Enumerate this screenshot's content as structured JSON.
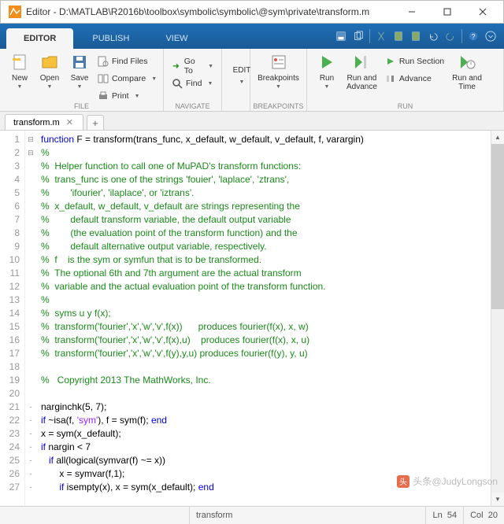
{
  "window": {
    "title": "Editor - D:\\MATLAB\\R2016b\\toolbox\\symbolic\\symbolic\\@sym\\private\\transform.m"
  },
  "tabs": {
    "editor": "EDITOR",
    "publish": "PUBLISH",
    "view": "VIEW"
  },
  "ribbon": {
    "file": {
      "label": "FILE",
      "new": "New",
      "open": "Open",
      "save": "Save",
      "findFiles": "Find Files",
      "compare": "Compare",
      "print": "Print"
    },
    "navigate": {
      "label": "NAVIGATE",
      "goto": "Go To",
      "find": "Find"
    },
    "edit": {
      "label": "EDIT"
    },
    "breakpoints": {
      "label": "BREAKPOINTS",
      "btn": "Breakpoints"
    },
    "run": {
      "label": "RUN",
      "run": "Run",
      "runAdvance": "Run and\nAdvance",
      "runSection": "Run Section",
      "advance": "Advance",
      "runTime": "Run and\nTime"
    }
  },
  "file_tab": "transform.m",
  "code": {
    "lines": [
      {
        "n": 1,
        "f": "⊟",
        "seg": [
          [
            "kw",
            "function"
          ],
          [
            "",
            " F = transform(trans_func, x_default, w_default, v_default, f, varargin)"
          ]
        ]
      },
      {
        "n": 2,
        "f": "⊟",
        "seg": [
          [
            "cm",
            "%"
          ]
        ]
      },
      {
        "n": 3,
        "seg": [
          [
            "cm",
            "%  Helper function to call one of MuPAD's transform functions:"
          ]
        ]
      },
      {
        "n": 4,
        "seg": [
          [
            "cm",
            "%  trans_func is one of the strings 'fouier', 'laplace', 'ztrans',"
          ]
        ]
      },
      {
        "n": 5,
        "seg": [
          [
            "cm",
            "%        'ifourier', 'ilaplace', or 'iztrans'."
          ]
        ]
      },
      {
        "n": 6,
        "seg": [
          [
            "cm",
            "%  x_default, w_default, v_default are strings representing the"
          ]
        ]
      },
      {
        "n": 7,
        "seg": [
          [
            "cm",
            "%        default transform variable, the default output variable"
          ]
        ]
      },
      {
        "n": 8,
        "seg": [
          [
            "cm",
            "%        (the evaluation point of the transform function) and the"
          ]
        ]
      },
      {
        "n": 9,
        "seg": [
          [
            "cm",
            "%        default alternative output variable, respectively."
          ]
        ]
      },
      {
        "n": 10,
        "seg": [
          [
            "cm",
            "%  f    is the sym or symfun that is to be transformed."
          ]
        ]
      },
      {
        "n": 11,
        "seg": [
          [
            "cm",
            "%  The optional 6th and 7th argument are the actual transform"
          ]
        ]
      },
      {
        "n": 12,
        "seg": [
          [
            "cm",
            "%  variable and the actual evaluation point of the transform function."
          ]
        ]
      },
      {
        "n": 13,
        "seg": [
          [
            "cm",
            "%"
          ]
        ]
      },
      {
        "n": 14,
        "seg": [
          [
            "cm",
            "%  syms u y f(x);"
          ]
        ]
      },
      {
        "n": 15,
        "seg": [
          [
            "cm",
            "%  transform('fourier','x','w','v',f(x))      produces fourier(f(x), x, w)"
          ]
        ]
      },
      {
        "n": 16,
        "seg": [
          [
            "cm",
            "%  transform('fourier','x','w','v',f(x),u)    produces fourier(f(x), x, u)"
          ]
        ]
      },
      {
        "n": 17,
        "seg": [
          [
            "cm",
            "%  transform('fourier','x','w','v',f(y),y,u) produces fourier(f(y), y, u)"
          ]
        ]
      },
      {
        "n": 18,
        "seg": [
          [
            "",
            ""
          ]
        ]
      },
      {
        "n": 19,
        "seg": [
          [
            "cm",
            "%   Copyright 2013 The MathWorks, Inc."
          ]
        ]
      },
      {
        "n": 20,
        "seg": [
          [
            "",
            ""
          ]
        ]
      },
      {
        "n": 21,
        "f": "-",
        "seg": [
          [
            "",
            "narginchk(5, 7);"
          ]
        ]
      },
      {
        "n": 22,
        "f": "-",
        "seg": [
          [
            "kw",
            "if"
          ],
          [
            "",
            " ~isa(f, "
          ],
          [
            "str",
            "'sym'"
          ],
          [
            "",
            ""
          ],
          [
            "",
            ")"
          ],
          [
            "",
            ", f = sym(f); "
          ],
          [
            "kw",
            "end"
          ]
        ]
      },
      {
        "n": 23,
        "f": "-",
        "seg": [
          [
            "",
            "x = sym(x_default);"
          ]
        ]
      },
      {
        "n": 24,
        "f": "-",
        "seg": [
          [
            "kw",
            "if"
          ],
          [
            "",
            " nargin < 7"
          ]
        ]
      },
      {
        "n": 25,
        "f": "-",
        "seg": [
          [
            "",
            "   "
          ],
          [
            "kw",
            "if"
          ],
          [
            "",
            " all(logical(symvar(f) ~= x))"
          ]
        ]
      },
      {
        "n": 26,
        "f": "-",
        "seg": [
          [
            "",
            "       x = symvar(f,1);"
          ]
        ]
      },
      {
        "n": 27,
        "f": "-",
        "seg": [
          [
            "",
            "       "
          ],
          [
            "kw",
            "if"
          ],
          [
            "",
            " isempty(x), x = sym(x_default); "
          ],
          [
            "kw",
            "end"
          ]
        ]
      }
    ]
  },
  "status": {
    "fn": "transform",
    "ln": "Ln",
    "lnv": "54",
    "col": "Col",
    "colv": "20"
  },
  "watermark": "头条@JudyLongson"
}
